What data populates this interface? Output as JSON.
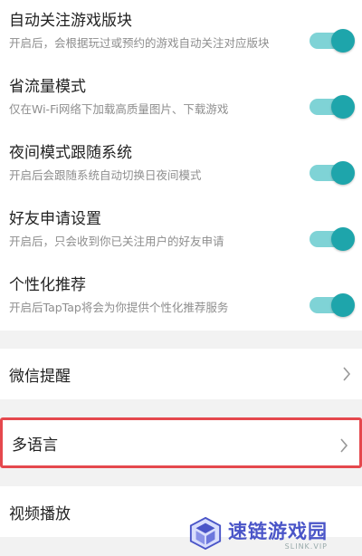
{
  "colors": {
    "toggle_track": "#7fd3d6",
    "toggle_knob": "#1ea5ab",
    "highlight": "#e5484d"
  },
  "toggles": [
    {
      "title": "自动关注游戏版块",
      "desc": "开启后，会根据玩过或预约的游戏自动关注对应版块",
      "on": true
    },
    {
      "title": "省流量模式",
      "desc": "仅在Wi-Fi网络下加载高质量图片、下载游戏",
      "on": true
    },
    {
      "title": "夜间模式跟随系统",
      "desc": "开启后会跟随系统自动切换日夜间模式",
      "on": true
    },
    {
      "title": "好友申请设置",
      "desc": "开启后，只会收到你已关注用户的好友申请",
      "on": true
    },
    {
      "title": "个性化推荐",
      "desc": "开启后TapTap将会为你提供个性化推荐服务",
      "on": true
    }
  ],
  "links": [
    {
      "label": "微信提醒",
      "icon": "chevron-right-icon"
    },
    {
      "label": "多语言",
      "icon": "chevron-right-icon"
    },
    {
      "label": "视频播放"
    }
  ],
  "watermark": {
    "main": "速链游戏园",
    "sub": "SLINK.VIP",
    "icon": "cube-logo-icon"
  }
}
